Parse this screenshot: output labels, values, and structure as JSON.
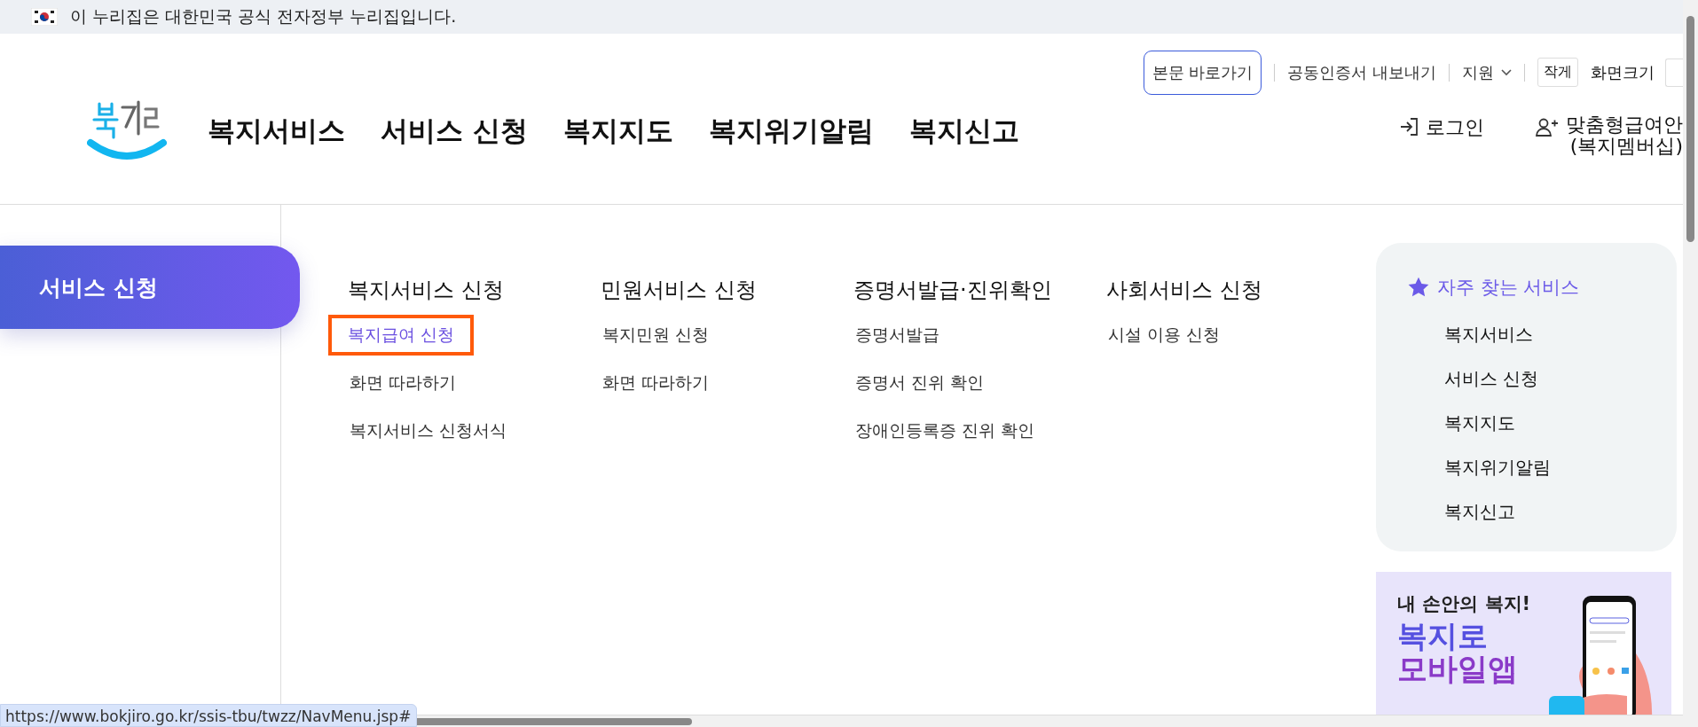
{
  "gov_banner": {
    "text": "이 누리집은 대한민국 공식 전자정부 누리집입니다."
  },
  "utility_links": [
    {
      "label": "본문 바로가기",
      "kind": "outlined"
    },
    {
      "label": "공동인증서 내보내기",
      "kind": "link"
    },
    {
      "label": "지원",
      "kind": "dropdown"
    },
    {
      "label": "작게",
      "kind": "boxed"
    },
    {
      "label": "화면크기",
      "kind": "text"
    }
  ],
  "nav": [
    "복지서비스",
    "서비스 신청",
    "복지지도",
    "복지위기알림",
    "복지신고"
  ],
  "account": [
    {
      "label": "로그인",
      "kind": "login"
    },
    {
      "label": "맞춤형급여안",
      "sublabel": "(복지멤버십)",
      "kind": "member"
    }
  ],
  "category": "서비스 신청",
  "menu_columns": [
    {
      "heading": "복지서비스 신청",
      "items": [
        {
          "label": "복지급여 신청",
          "selected": true
        },
        {
          "label": "화면 따라하기",
          "selected": false
        },
        {
          "label": "복지서비스 신청서식",
          "selected": false
        }
      ]
    },
    {
      "heading": "민원서비스 신청",
      "items": [
        {
          "label": "복지민원 신청",
          "selected": false
        },
        {
          "label": "화면 따라하기",
          "selected": false
        }
      ]
    },
    {
      "heading": "증명서발급·진위확인",
      "items": [
        {
          "label": "증명서발급",
          "selected": false
        },
        {
          "label": "증명서 진위 확인",
          "selected": false
        },
        {
          "label": "장애인등록증 진위 확인",
          "selected": false
        }
      ]
    },
    {
      "heading": "사회서비스 신청",
      "items": [
        {
          "label": "시설 이용 신청",
          "selected": false
        }
      ]
    }
  ],
  "favorites": {
    "title": "자주 찾는 서비스",
    "items": [
      "복지서비스",
      "서비스 신청",
      "복지지도",
      "복지위기알림",
      "복지신고"
    ]
  },
  "promo": {
    "lines": [
      "내 손안의 복지!",
      "복지로",
      "모바일앱"
    ]
  },
  "status_url": "https://www.bokjiro.go.kr/ssis-tbu/twzz/NavMenu.jsp#"
}
